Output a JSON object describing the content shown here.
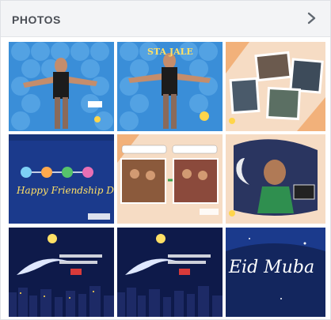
{
  "header": {
    "title": "PHOTOS",
    "chevron_icon": "chevron-right-icon"
  },
  "photos": [
    {
      "id": "photo-1",
      "caption": ""
    },
    {
      "id": "photo-2",
      "caption": "STA JALE"
    },
    {
      "id": "photo-3",
      "caption": ""
    },
    {
      "id": "photo-4",
      "caption": "Happy Friendship Day"
    },
    {
      "id": "photo-5",
      "caption": ""
    },
    {
      "id": "photo-6",
      "caption": ""
    },
    {
      "id": "photo-7",
      "caption": ""
    },
    {
      "id": "photo-8",
      "caption": ""
    },
    {
      "id": "photo-9",
      "caption": "Eid Muba"
    }
  ],
  "colors": {
    "header_bg": "#f3f4f6",
    "title": "#4b4f56",
    "blue_bg": "#3a8ed8",
    "navy_bg": "#1b3a8c",
    "night_bg": "#0e1a4a",
    "peach_bg": "#f6dcc4"
  }
}
